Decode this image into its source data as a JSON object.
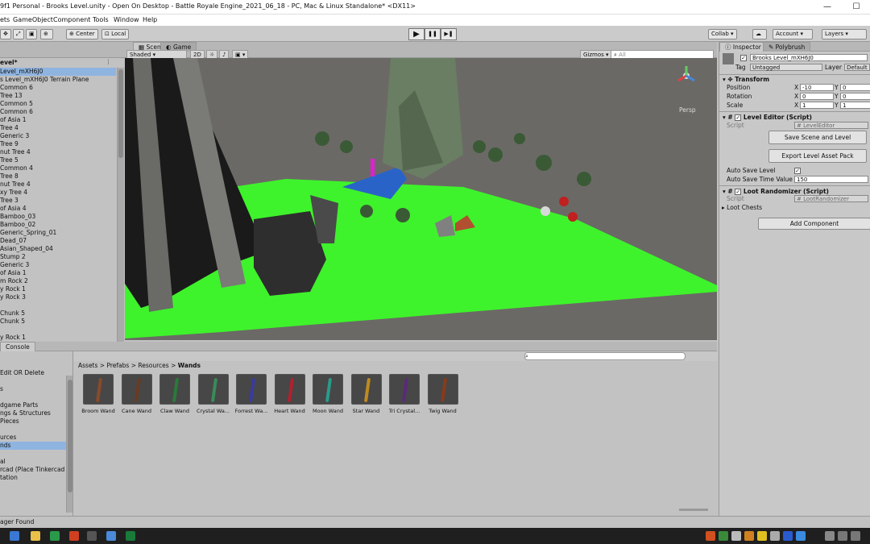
{
  "window": {
    "title": "9f1 Personal - Brooks Level.unity - Open On Desktop - Battle Royale Engine_2021_06_18 - PC, Mac & Linux Standalone* <DX11>"
  },
  "menu": [
    "ets",
    "GameObject",
    "Component",
    "Tools",
    "Window",
    "Help"
  ],
  "toolbar": {
    "center": "Center",
    "local": "Local",
    "play": "▶",
    "pause": "❚❚",
    "step": "▶❚",
    "collab": "Collab ▾",
    "account": "Account",
    "layers": "Layers"
  },
  "hierarchy": {
    "title": "evel*",
    "items": [
      "Level_mXH6J0",
      "s Level_mXH6J0 Terrain Plane",
      "Common 6",
      "Tree 13",
      "Common 5",
      "Common 6",
      "of Asia 1",
      "Tree 4",
      "Generic 3",
      "Tree 9",
      "nut Tree 4",
      "Tree 5",
      "Common 4",
      "Tree 8",
      "nut Tree 4",
      "xy Tree 4",
      "Tree 3",
      "of Asia 4",
      "Bamboo_03",
      "Bamboo_02",
      "Generic_Spring_01",
      "Dead_07",
      "Asian_Shaped_04",
      "Stump 2",
      "Generic 3",
      "of Asia 1",
      "m Rock 2",
      "y Rock 1",
      "y Rock 3",
      "",
      "Chunk 5",
      "Chunk 5",
      "",
      "y Rock 1"
    ]
  },
  "scene": {
    "tabs": [
      "Scene",
      "Game"
    ],
    "shading": "Shaded",
    "mode2d": "2D",
    "gizmos": "Gizmos",
    "persp": "Persp",
    "search_placeholder": "All"
  },
  "console_tab": "Console",
  "project": {
    "left_items": [
      "Edit OR Delete",
      "",
      "s",
      "",
      "dgame Parts",
      "ngs & Structures",
      "Pieces",
      "",
      "urces",
      "nds",
      "",
      "al",
      "rcad (Place Tinkercad C",
      "tation"
    ],
    "breadcrumb": [
      "Assets",
      "Prefabs",
      "Resources",
      "Wands"
    ],
    "assets": [
      {
        "name": "Broom Wand",
        "color": "#8a4a2a"
      },
      {
        "name": "Cane Wand",
        "color": "#6a3a22"
      },
      {
        "name": "Claw Wand",
        "color": "#2a7a3a"
      },
      {
        "name": "Crystal Wa...",
        "color": "#3a8a5a"
      },
      {
        "name": "Forrest Wa...",
        "color": "#3a3aa0"
      },
      {
        "name": "Heart Wand",
        "color": "#b02030"
      },
      {
        "name": "Moon Wand",
        "color": "#2a9a8a"
      },
      {
        "name": "Star Wand",
        "color": "#c08a20"
      },
      {
        "name": "Tri Crystal...",
        "color": "#5a2a7a"
      },
      {
        "name": "Twig Wand",
        "color": "#8a3a1a"
      }
    ]
  },
  "status": "ager Found",
  "inspector": {
    "tabs": [
      "Inspector",
      "Polybrush"
    ],
    "object_name": "Brooks Level_mXH6J0",
    "tag_label": "Tag",
    "tag_value": "Untagged",
    "layer_label": "Layer",
    "layer_value": "Default",
    "transform": {
      "title": "Transform",
      "position": {
        "label": "Position",
        "x": "-10",
        "y": "0"
      },
      "rotation": {
        "label": "Rotation",
        "x": "0",
        "y": "0"
      },
      "scale": {
        "label": "Scale",
        "x": "1",
        "y": "1"
      }
    },
    "level_editor": {
      "title": "Level Editor (Script)",
      "script_label": "Script",
      "script_value": "LevelEditor",
      "save_button": "Save Scene and Level",
      "export_button": "Export Level Asset Pack",
      "auto_save_label": "Auto Save Level",
      "auto_save_time_label": "Auto Save Time Value",
      "auto_save_time_value": "150"
    },
    "loot_randomizer": {
      "title": "Loot Randomizer (Script)",
      "script_label": "Script",
      "script_value": "LootRandomizer",
      "loot_chests": "Loot Chests"
    },
    "add_component": "Add Component"
  }
}
